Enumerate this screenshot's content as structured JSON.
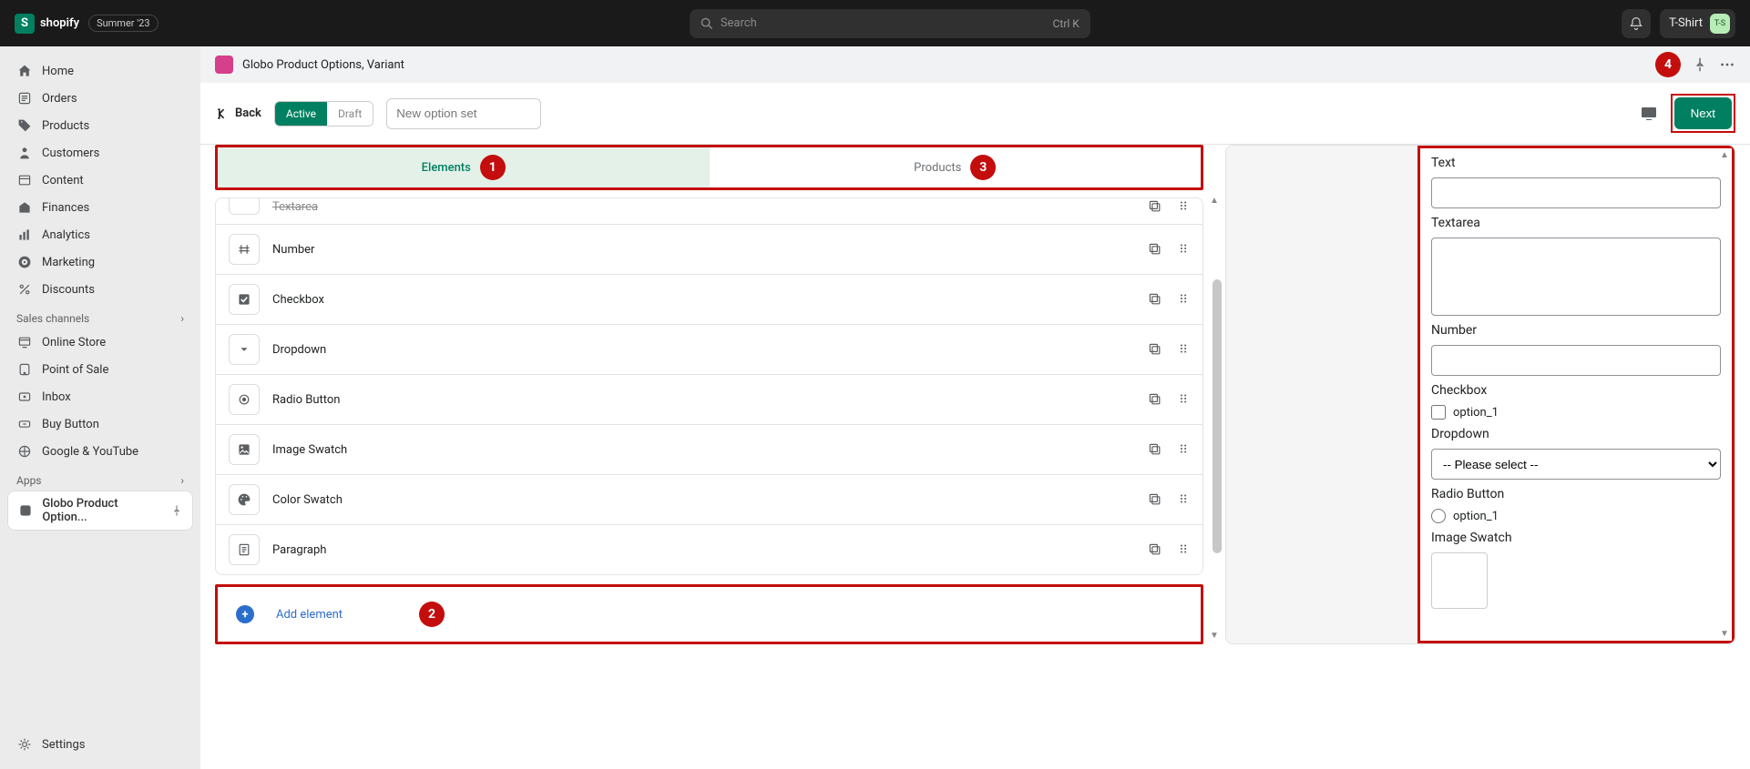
{
  "topbar": {
    "brand": "shopify",
    "badge": "Summer '23",
    "search_placeholder": "Search",
    "search_kbd": "Ctrl K",
    "store_name": "T-Shirt",
    "store_initials": "T-S"
  },
  "sidebar": {
    "items": [
      {
        "label": "Home"
      },
      {
        "label": "Orders"
      },
      {
        "label": "Products"
      },
      {
        "label": "Customers"
      },
      {
        "label": "Content"
      },
      {
        "label": "Finances"
      },
      {
        "label": "Analytics"
      },
      {
        "label": "Marketing"
      },
      {
        "label": "Discounts"
      }
    ],
    "sales_channels_header": "Sales channels",
    "channels": [
      {
        "label": "Online Store"
      },
      {
        "label": "Point of Sale"
      },
      {
        "label": "Inbox"
      },
      {
        "label": "Buy Button"
      },
      {
        "label": "Google & YouTube"
      }
    ],
    "apps_header": "Apps",
    "apps": [
      {
        "label": "Globo Product Option..."
      }
    ],
    "settings": "Settings"
  },
  "app_header": {
    "title": "Globo Product Options, Variant"
  },
  "toolbar": {
    "back": "Back",
    "active": "Active",
    "draft": "Draft",
    "name_placeholder": "New option set",
    "next": "Next"
  },
  "tabs": {
    "elements": "Elements",
    "products": "Products"
  },
  "elements": [
    {
      "label": "Textarea"
    },
    {
      "label": "Number"
    },
    {
      "label": "Checkbox"
    },
    {
      "label": "Dropdown"
    },
    {
      "label": "Radio Button"
    },
    {
      "label": "Image Swatch"
    },
    {
      "label": "Color Swatch"
    },
    {
      "label": "Paragraph"
    }
  ],
  "add_element": "Add element",
  "preview": {
    "text_label": "Text",
    "textarea_label": "Textarea",
    "number_label": "Number",
    "checkbox_label": "Checkbox",
    "checkbox_option": "option_1",
    "dropdown_label": "Dropdown",
    "dropdown_placeholder": "-- Please select --",
    "radio_label": "Radio Button",
    "radio_option": "option_1",
    "swatch_label": "Image Swatch"
  },
  "callouts": {
    "one": "1",
    "two": "2",
    "three": "3",
    "four": "4"
  }
}
